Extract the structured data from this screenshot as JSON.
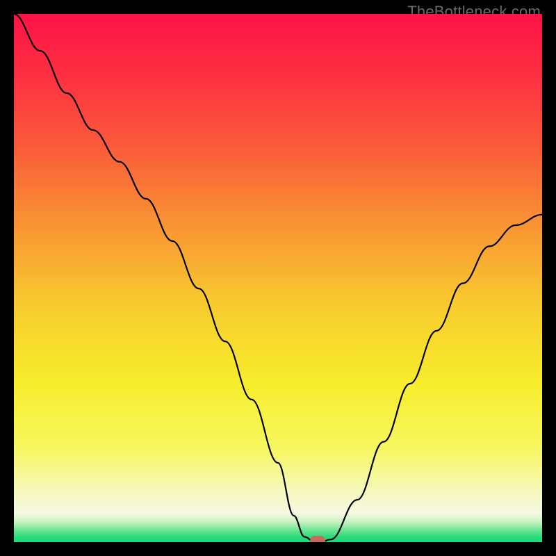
{
  "watermark": "TheBottleneck.com",
  "chart_data": {
    "type": "line",
    "title": "",
    "xlabel": "",
    "ylabel": "",
    "xlim": [
      0,
      100
    ],
    "ylim": [
      0,
      100
    ],
    "x": [
      0,
      5,
      10,
      15,
      20,
      25,
      30,
      35,
      40,
      45,
      50,
      53,
      55,
      57,
      58,
      60,
      65,
      70,
      75,
      80,
      85,
      90,
      95,
      100
    ],
    "values": [
      100,
      93,
      85,
      78,
      72,
      65,
      57,
      48,
      38,
      27,
      15,
      5,
      1,
      0,
      0,
      0.5,
      8,
      19,
      30,
      40,
      49,
      56,
      60,
      62
    ],
    "marker": {
      "x": 57.5,
      "y": 0.2
    },
    "gradient_stops": [
      {
        "offset": 0.0,
        "color": "#fd1347"
      },
      {
        "offset": 0.12,
        "color": "#fd3041"
      },
      {
        "offset": 0.25,
        "color": "#fb5a3a"
      },
      {
        "offset": 0.4,
        "color": "#f99433"
      },
      {
        "offset": 0.55,
        "color": "#f8cb2e"
      },
      {
        "offset": 0.7,
        "color": "#f7ed2c"
      },
      {
        "offset": 0.82,
        "color": "#f7f75e"
      },
      {
        "offset": 0.9,
        "color": "#f6f8b8"
      },
      {
        "offset": 0.945,
        "color": "#f5f9e2"
      },
      {
        "offset": 0.96,
        "color": "#d0f3c5"
      },
      {
        "offset": 0.975,
        "color": "#7be79a"
      },
      {
        "offset": 0.99,
        "color": "#2adb7d"
      },
      {
        "offset": 1.0,
        "color": "#19d876"
      }
    ]
  }
}
